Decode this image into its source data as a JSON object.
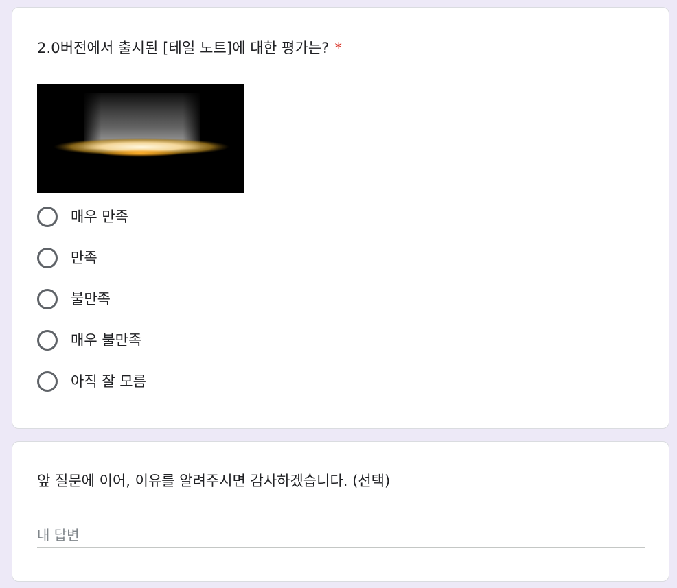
{
  "question1": {
    "title": "2.0버전에서 출시된 [테일 노트]에 대한 평가는?",
    "required_mark": "*",
    "image_icon": "glowing-light-image",
    "options": [
      {
        "label": "매우 만족"
      },
      {
        "label": "만족"
      },
      {
        "label": "불만족"
      },
      {
        "label": "매우 불만족"
      },
      {
        "label": "아직 잘 모름"
      }
    ]
  },
  "question2": {
    "title": "앞 질문에 이어, 이유를 알려주시면 감사하겠습니다. (선택)",
    "placeholder": "내 답변",
    "value": ""
  },
  "colors": {
    "background": "#ede9f7",
    "card": "#ffffff",
    "required": "#d93025",
    "radio_border": "#5f6368"
  }
}
